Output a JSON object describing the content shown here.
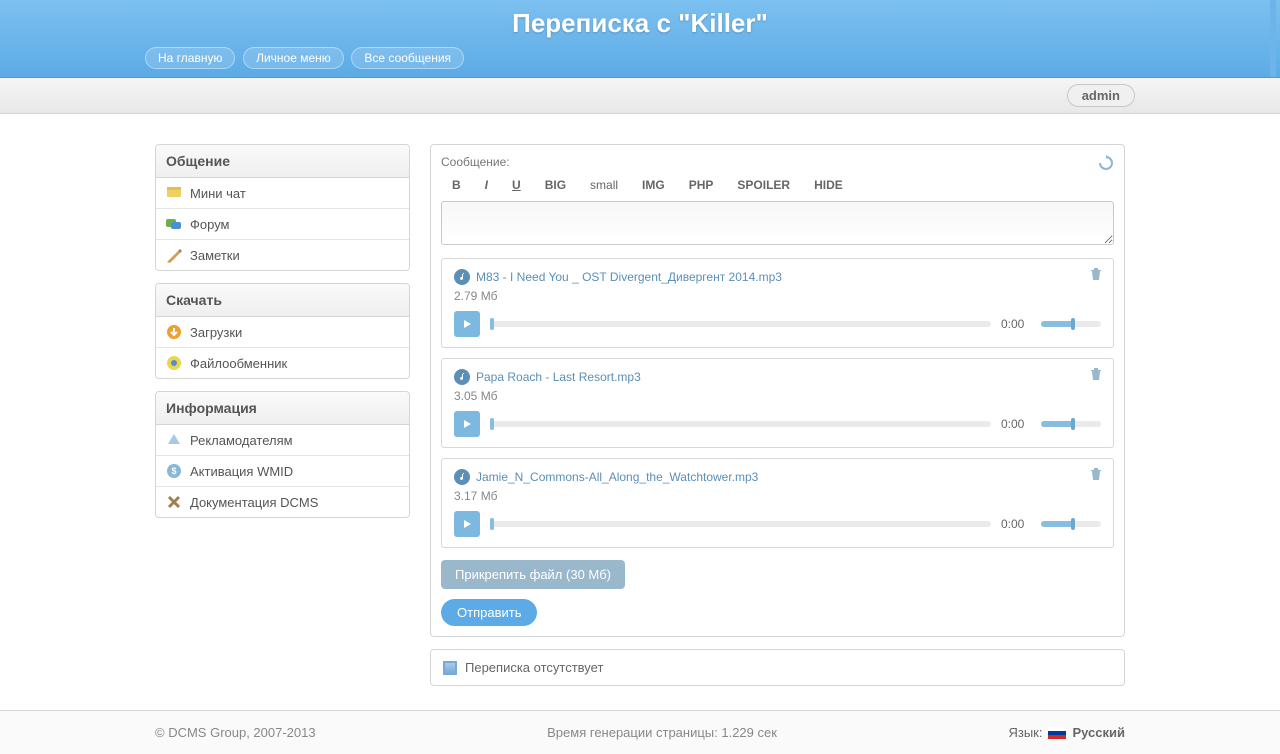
{
  "header": {
    "title": "Переписка с \"Killer\"",
    "nav": [
      {
        "label": "На главную"
      },
      {
        "label": "Личное меню"
      },
      {
        "label": "Все сообщения"
      }
    ]
  },
  "user": {
    "name": "admin"
  },
  "sidebar": [
    {
      "title": "Общение",
      "items": [
        {
          "icon": "chat-icon",
          "label": "Мини чат"
        },
        {
          "icon": "forum-icon",
          "label": "Форум"
        },
        {
          "icon": "notes-icon",
          "label": "Заметки"
        }
      ]
    },
    {
      "title": "Скачать",
      "items": [
        {
          "icon": "download-icon",
          "label": "Загрузки"
        },
        {
          "icon": "fileshare-icon",
          "label": "Файлообменник"
        }
      ]
    },
    {
      "title": "Информация",
      "items": [
        {
          "icon": "ads-icon",
          "label": "Рекламодателям"
        },
        {
          "icon": "wmid-icon",
          "label": "Активация WMID"
        },
        {
          "icon": "docs-icon",
          "label": "Документация DCMS"
        }
      ]
    }
  ],
  "compose": {
    "label": "Сообщение:",
    "toolbar": [
      "B",
      "I",
      "U",
      "BIG",
      "small",
      "IMG",
      "PHP",
      "SPOILER",
      "HIDE"
    ],
    "attachments": [
      {
        "name": "M83 - I Need You _ OST Divergent_Дивергент 2014.mp3",
        "size": "2.79 Мб",
        "time": "0:00"
      },
      {
        "name": "Papa Roach - Last Resort.mp3",
        "size": "3.05 Мб",
        "time": "0:00"
      },
      {
        "name": "Jamie_N_Commons-All_Along_the_Watchtower.mp3",
        "size": "3.17 Мб",
        "time": "0:00"
      }
    ],
    "attach_btn": "Прикрепить файл (30 Мб)",
    "send_btn": "Отправить"
  },
  "empty_msg": "Переписка отсутствует",
  "footer": {
    "copyright": "© DCMS Group, 2007-2013",
    "gentime": "Время генерации страницы: 1.229 сек",
    "lang_label": "Язык:",
    "lang": "Русский"
  }
}
